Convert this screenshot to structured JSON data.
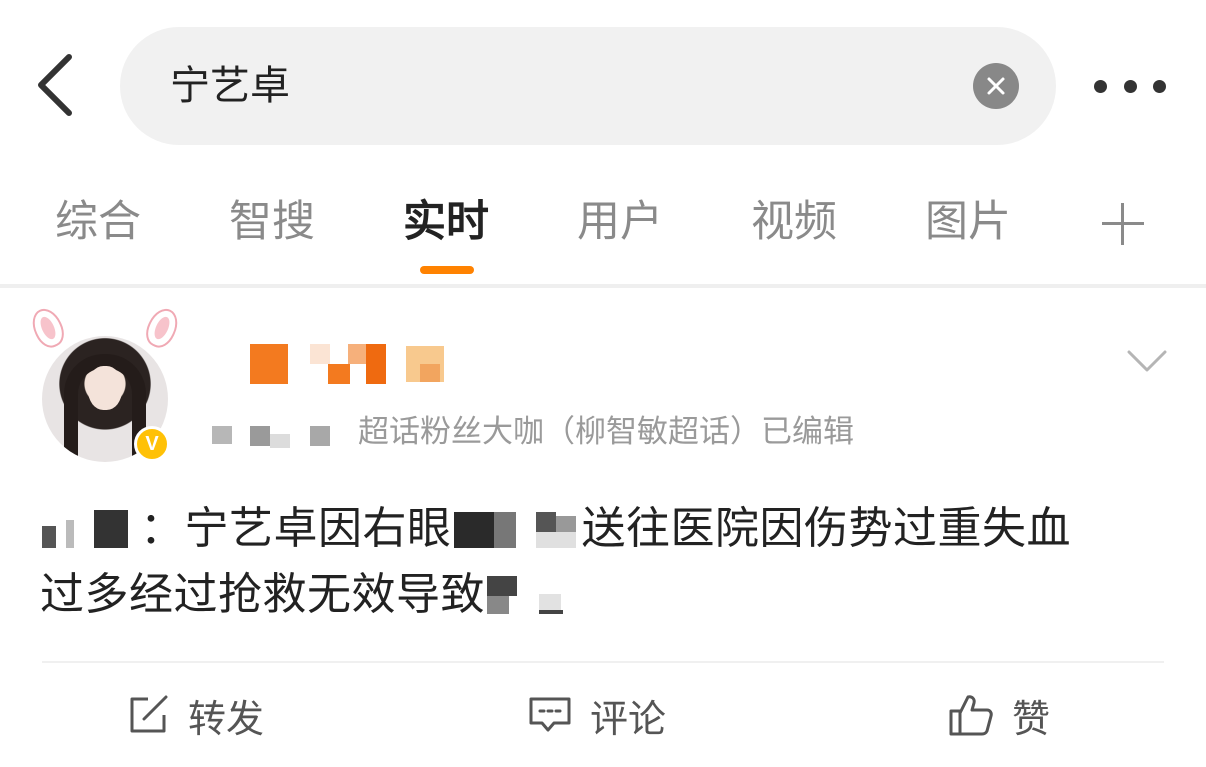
{
  "search": {
    "query": "宁艺卓"
  },
  "tabs": [
    {
      "label": "综合"
    },
    {
      "label": "智搜"
    },
    {
      "label": "实时"
    },
    {
      "label": "用户"
    },
    {
      "label": "视频"
    },
    {
      "label": "图片"
    }
  ],
  "active_tab": "实时",
  "colors": {
    "accent": "#ff8200",
    "badge": "#ffc107"
  },
  "post": {
    "meta": "超话粉丝大咖（柳智敏超话）已编辑",
    "body_line1_a": "：宁艺卓因右眼",
    "body_line1_b": "送往医院因伤势过重失血",
    "body_line2": "过多经过抢救无效导致"
  },
  "actions": {
    "repost": "转发",
    "comment": "评论",
    "like": "赞"
  },
  "icons": {
    "back": "chevron-left-icon",
    "clear": "close-circle-icon",
    "more": "more-dots-icon",
    "add_tab": "plus-icon",
    "expand": "chevron-down-icon",
    "repost": "share-icon",
    "comment": "comment-icon",
    "like": "thumbs-up-icon"
  }
}
